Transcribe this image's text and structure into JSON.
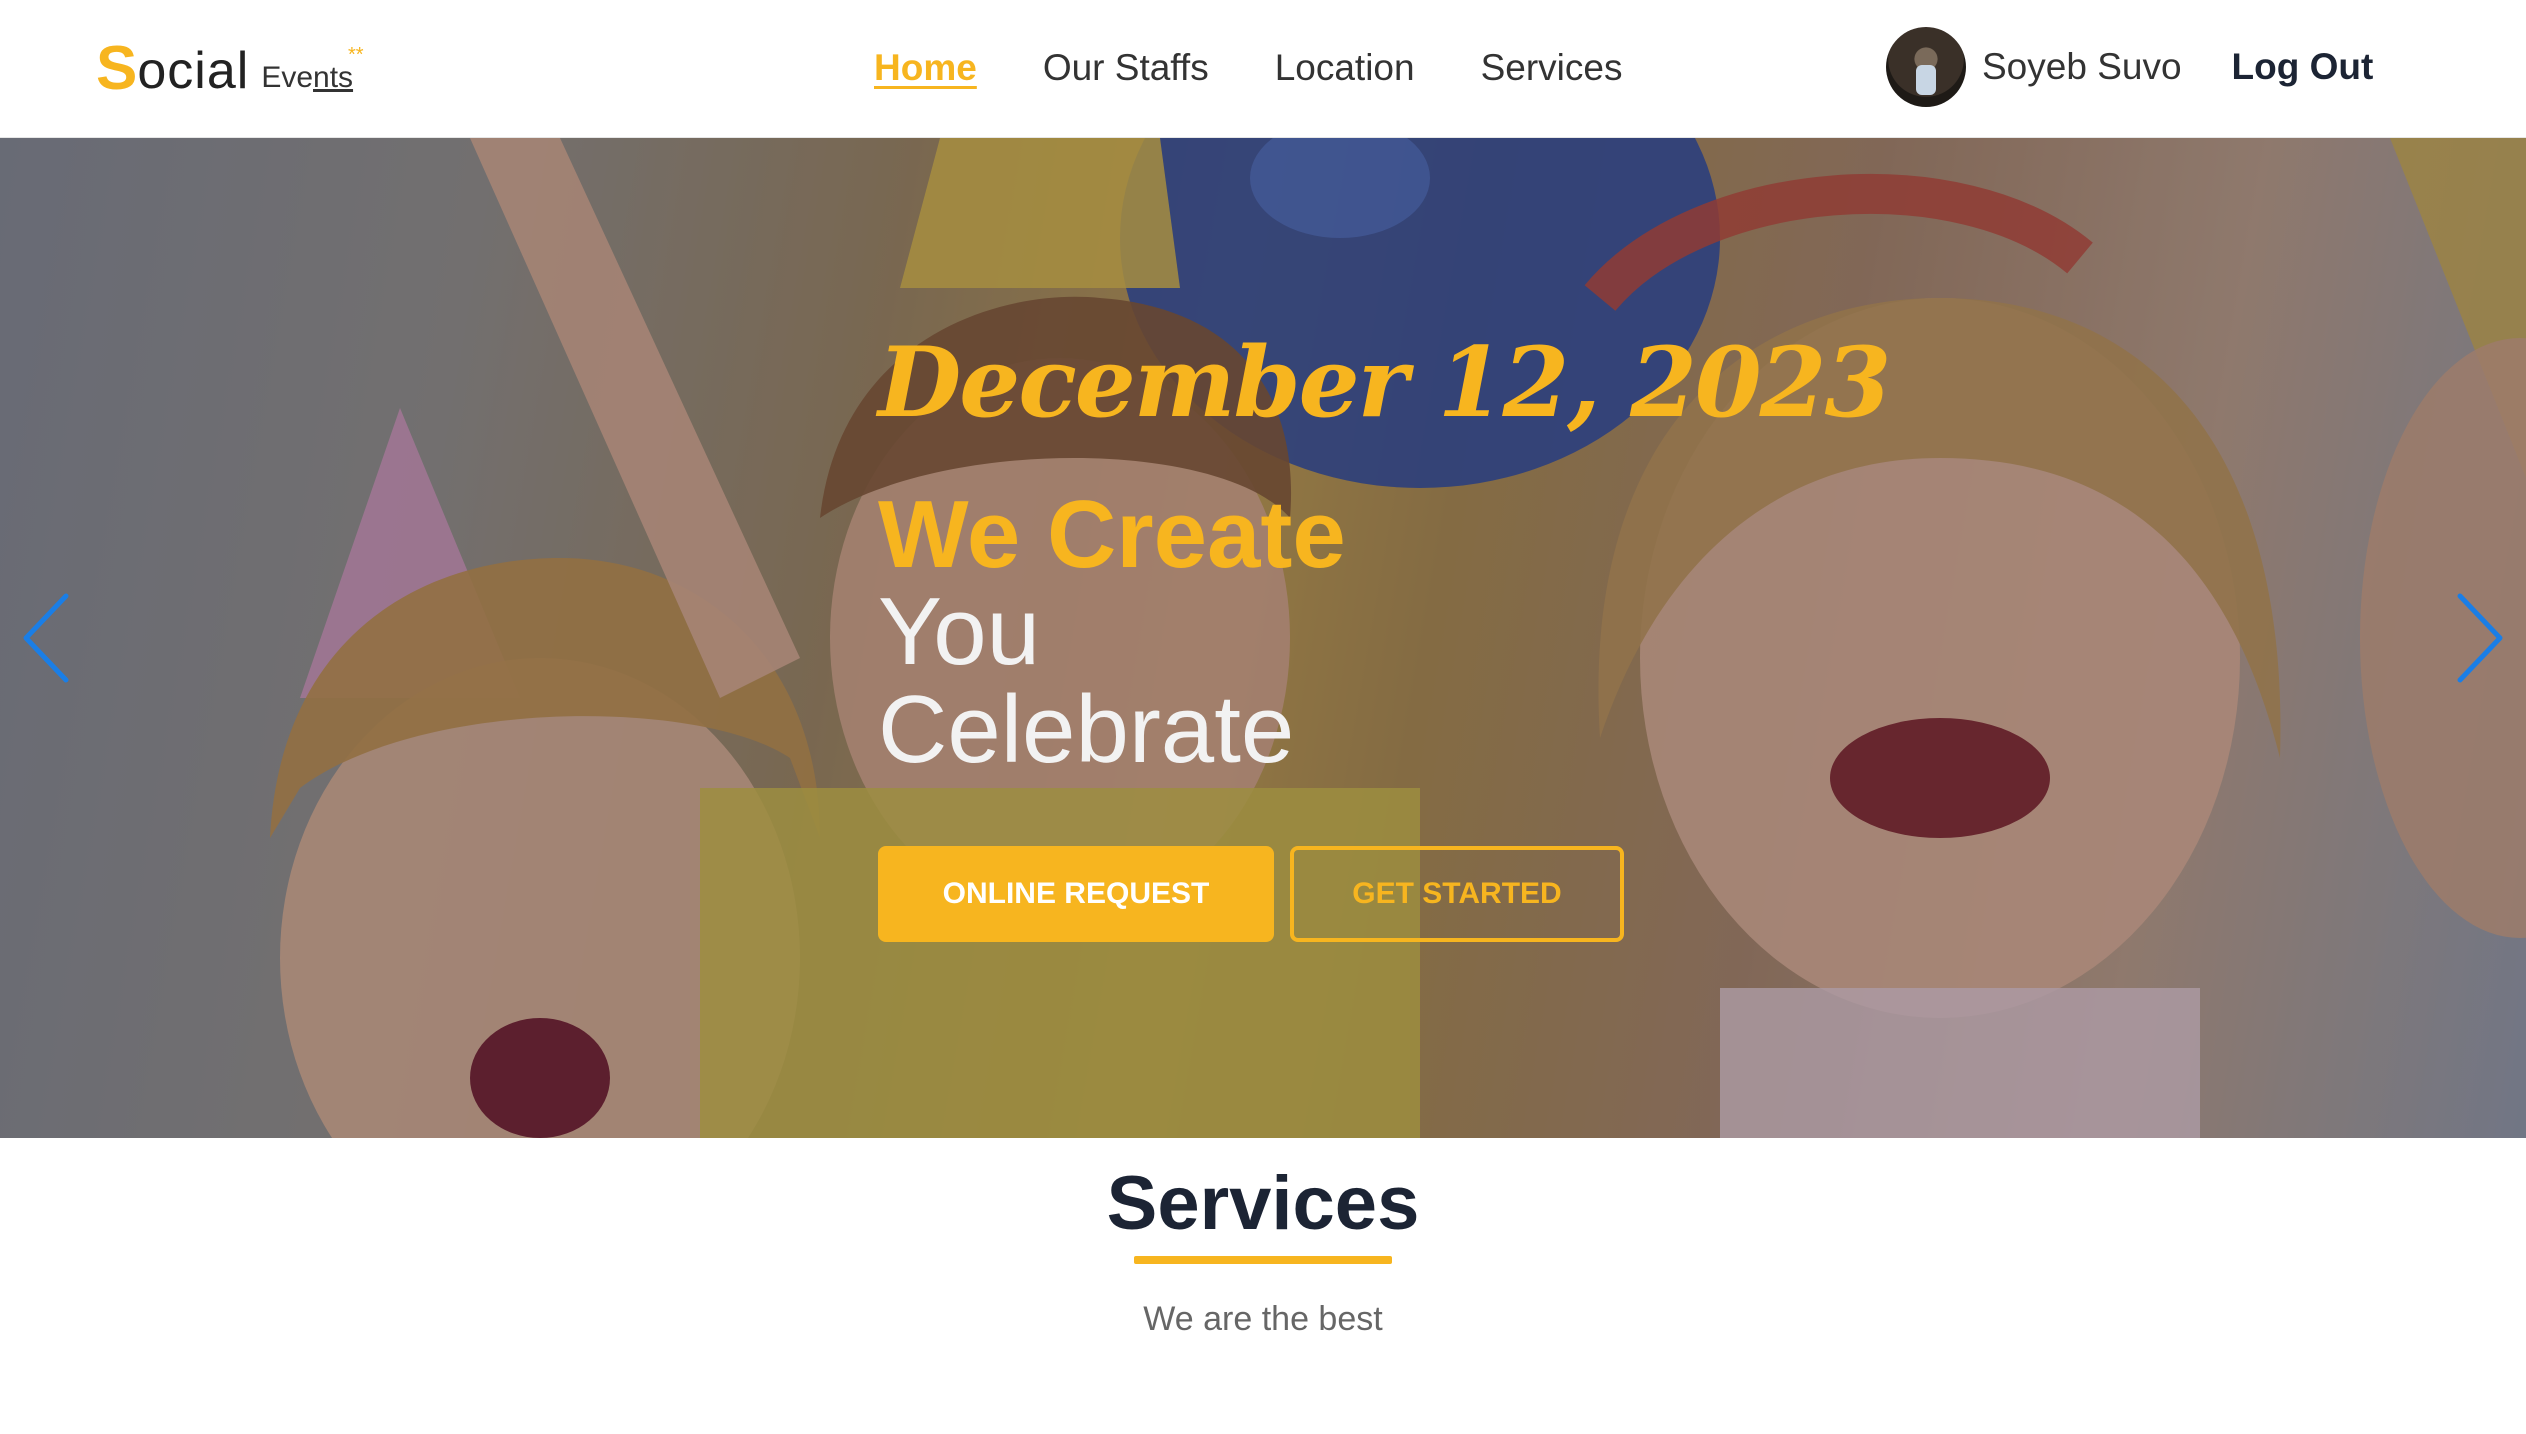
{
  "brand": {
    "logo_first_letter": "S",
    "logo_rest": "ocial",
    "logo_events_prefix": "Eve",
    "logo_events_underlined": "nts",
    "logo_stars": "**",
    "accent_color": "#f7b51f",
    "dark_color": "#1c2434"
  },
  "nav": {
    "items": [
      {
        "label": "Home",
        "active": true
      },
      {
        "label": "Our Staffs",
        "active": false
      },
      {
        "label": "Location",
        "active": false
      },
      {
        "label": "Services",
        "active": false
      }
    ]
  },
  "user": {
    "name": "Soyeb Suvo",
    "avatar_icon": "user-avatar",
    "logout_label": "Log Out"
  },
  "hero": {
    "date": "December 12, 2023",
    "headline_1": "We Create",
    "headline_2": "You",
    "headline_3": "Celebrate",
    "primary_button": "ONLINE REQUEST",
    "secondary_button": "GET STARTED",
    "prev_icon": "chevron-left-icon",
    "next_icon": "chevron-right-icon",
    "arrow_color": "#1a7ee6"
  },
  "services": {
    "title": "Services",
    "subtitle": "We are the best"
  }
}
